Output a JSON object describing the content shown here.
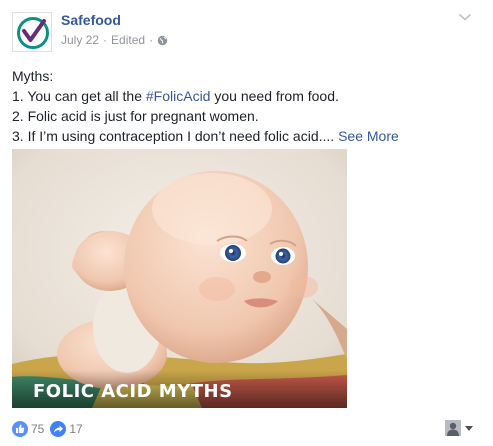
{
  "post": {
    "page_name": "Safefood",
    "date": "July 22",
    "edited": "Edited",
    "dot": "·",
    "audience_icon": "globe-icon",
    "options_icon": "chevron-down-icon",
    "text": {
      "intro": "Myths:",
      "line1_before": "1. You can get all the ",
      "line1_hashtag": "#FolicAcid",
      "line1_after": " you need from food.",
      "line2": "2. Folic acid is just for pregnant women.",
      "line3": "3. If I’m using contraception I don’t need folic acid....",
      "see_more": "See More"
    },
    "image": {
      "caption": "FOLIC ACID MYTHS"
    },
    "reactions": {
      "likes": "75",
      "shares": "17"
    }
  },
  "colors": {
    "link": "#365899",
    "logo_teal": "#0e8f84",
    "logo_purple": "#6a2a78",
    "like_blue": "#5890ff"
  }
}
